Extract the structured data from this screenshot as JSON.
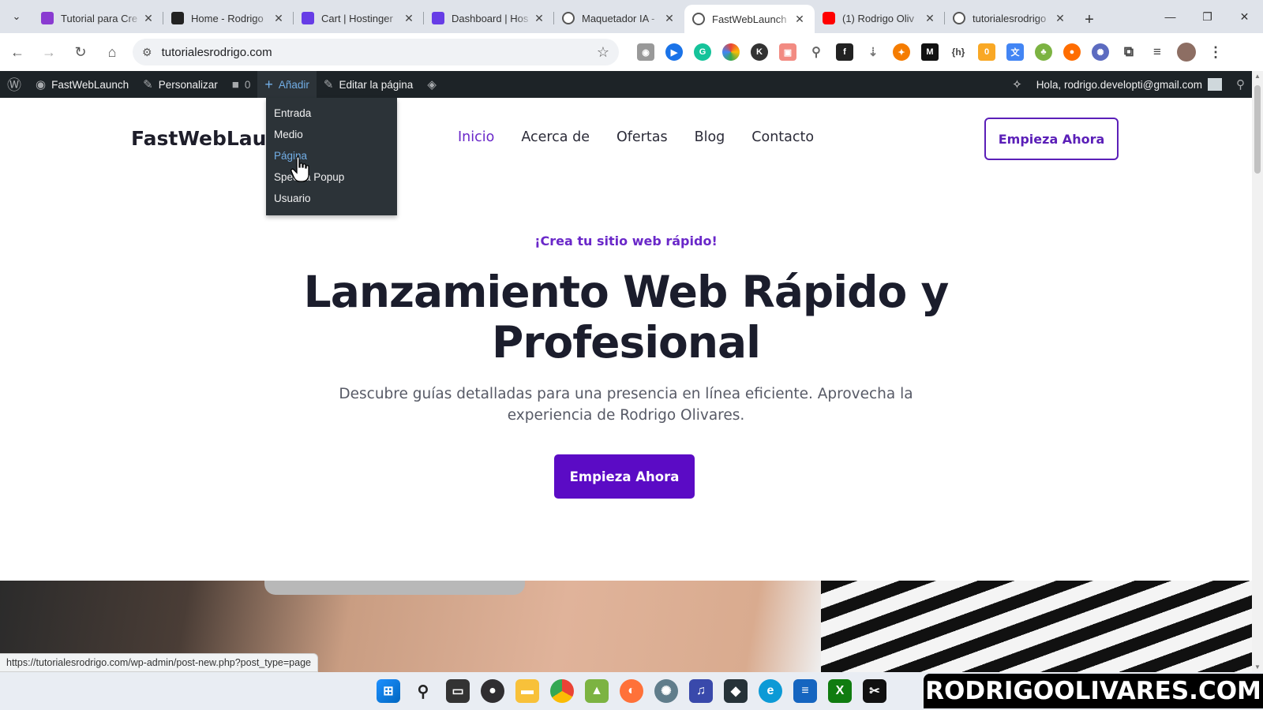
{
  "browser": {
    "tabs": [
      {
        "title": "Tutorial para Cre",
        "favicon": "#8a3bd1"
      },
      {
        "title": "Home - Rodrigo",
        "favicon": "#222222"
      },
      {
        "title": "Cart | Hostinger",
        "favicon": "#673de6"
      },
      {
        "title": "Dashboard | Hos",
        "favicon": "#673de6"
      },
      {
        "title": "Maquetador IA -",
        "favicon": "#555555"
      },
      {
        "title": "FastWebLaunch",
        "favicon": "#555555"
      },
      {
        "title": "(1) Rodrigo Oliv",
        "favicon": "#ff0000"
      },
      {
        "title": "tutorialesrodrigo",
        "favicon": "#555555"
      }
    ],
    "active_tab_index": 5,
    "url": "tutorialesrodrigo.com",
    "status_url": "https://tutorialesrodrigo.com/wp-admin/post-new.php?post_type=page"
  },
  "wp_admin_bar": {
    "site_name": "FastWebLaunch",
    "customize": "Personalizar",
    "comments_count": "0",
    "add_new": "Añadir",
    "edit_page": "Editar la página",
    "greeting": "Hola, rodrigo.developti@gmail.com",
    "add_menu": [
      "Entrada",
      "Medio",
      "Página",
      "Spectra Popup",
      "Usuario"
    ],
    "hovered_item": "Página"
  },
  "site": {
    "logo": "FastWebLaunch",
    "nav": [
      "Inicio",
      "Acerca de",
      "Ofertas",
      "Blog",
      "Contacto"
    ],
    "active_nav": "Inicio",
    "header_cta": "Empieza Ahora",
    "kicker": "¡Crea tu sitio web rápido!",
    "hero_line1": "Lanzamiento Web Rápido y",
    "hero_line2": "Profesional",
    "subtitle": "Descubre guías detalladas para una presencia en línea eficiente. Aprovecha la experiencia de Rodrigo Olivares.",
    "hero_cta": "Empieza Ahora",
    "accent_color": "#5b0bc5"
  },
  "watermark": "RODRIGOOLIVARES.COM"
}
